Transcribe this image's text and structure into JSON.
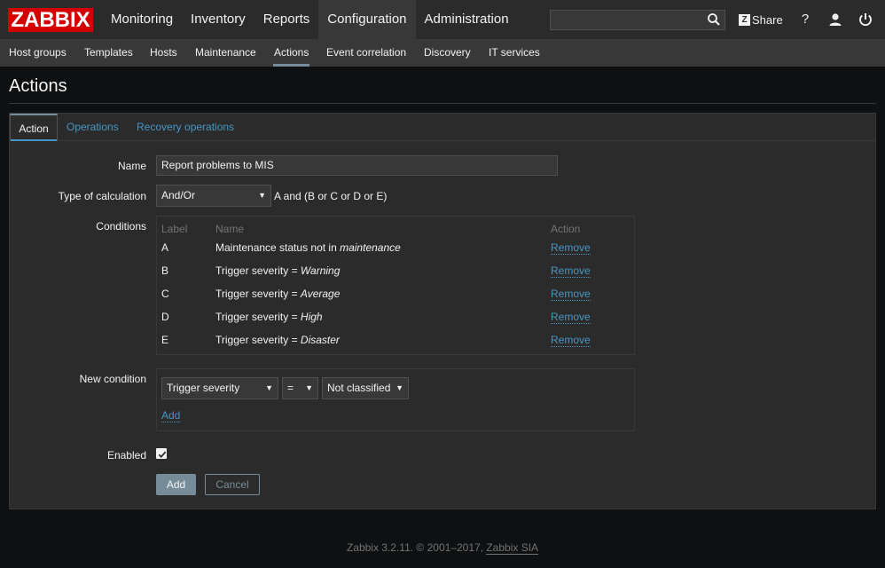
{
  "brand": {
    "logo_text": "ZABBIX",
    "accent": "#d40000"
  },
  "main_menu": [
    "Monitoring",
    "Inventory",
    "Reports",
    "Configuration",
    "Administration"
  ],
  "main_menu_active": "Configuration",
  "header_actions": {
    "share_label": "Share",
    "share_icon_glyph": "Z",
    "help_glyph": "?"
  },
  "sub_menu": [
    "Host groups",
    "Templates",
    "Hosts",
    "Maintenance",
    "Actions",
    "Event correlation",
    "Discovery",
    "IT services"
  ],
  "sub_menu_active": "Actions",
  "page": {
    "title": "Actions"
  },
  "tabs": [
    "Action",
    "Operations",
    "Recovery operations"
  ],
  "tabs_active": "Action",
  "form": {
    "name_label": "Name",
    "name_value": "Report problems to MIS",
    "calc_label": "Type of calculation",
    "calc_value": "And/Or",
    "calc_formula": "A and (B or C or D or E)",
    "conditions_label": "Conditions",
    "conditions_headers": {
      "label": "Label",
      "name": "Name",
      "action": "Action"
    },
    "conditions": [
      {
        "label": "A",
        "prefix": "Maintenance status not in ",
        "value": "maintenance",
        "action": "Remove"
      },
      {
        "label": "B",
        "prefix": "Trigger severity = ",
        "value": "Warning",
        "action": "Remove"
      },
      {
        "label": "C",
        "prefix": "Trigger severity = ",
        "value": "Average",
        "action": "Remove"
      },
      {
        "label": "D",
        "prefix": "Trigger severity = ",
        "value": "High",
        "action": "Remove"
      },
      {
        "label": "E",
        "prefix": "Trigger severity = ",
        "value": "Disaster",
        "action": "Remove"
      }
    ],
    "new_condition_label": "New condition",
    "new_condition_type": "Trigger severity",
    "new_condition_operator": "=",
    "new_condition_value": "Not classified",
    "new_condition_add": "Add",
    "enabled_label": "Enabled",
    "enabled_checked": true,
    "add_button": "Add",
    "cancel_button": "Cancel"
  },
  "footer": {
    "version_text": "Zabbix 3.2.11. © 2001–2017, ",
    "company": "Zabbix SIA"
  }
}
